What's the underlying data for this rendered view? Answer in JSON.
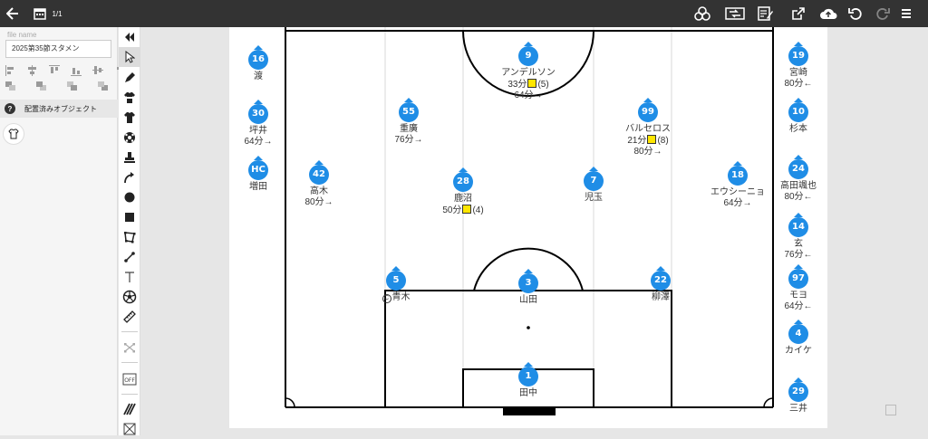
{
  "topbar": {
    "page_counter": "1/1",
    "icons": [
      "back-arrow-icon",
      "calendar-icon",
      "circles-icon",
      "substitution-icon",
      "edit-note-icon",
      "share-icon",
      "cloud-upload-icon",
      "undo-icon",
      "redo-icon",
      "menu-icon"
    ]
  },
  "sidebar": {
    "file_name_label": "file name",
    "file_name_value": "2025第35節スタメン",
    "objects_header": "配置済みオブジェクト"
  },
  "toolbar": {
    "tools": [
      "collapse",
      "select",
      "pen",
      "shirt-dark",
      "shirt-black",
      "ball",
      "stamp",
      "curve-arrow",
      "circle",
      "rectangle",
      "polygon",
      "line",
      "text",
      "ball-outline",
      "ruler",
      "formation",
      "off",
      "stripes",
      "pattern"
    ]
  },
  "pitch": {
    "starters": [
      {
        "id": "p9",
        "number": "9",
        "name": "アンデルソン",
        "lines": [
          {
            "pre": "33分",
            "card": "yellow",
            "post": "(5)"
          },
          {
            "text": "64分→"
          }
        ]
      },
      {
        "id": "p55",
        "number": "55",
        "name": "重廣",
        "lines": [
          {
            "text": "76分→"
          }
        ]
      },
      {
        "id": "p99",
        "number": "99",
        "name": "バルセロス",
        "lines": [
          {
            "pre": "21分",
            "card": "yellow",
            "post": "(8)"
          },
          {
            "text": "80分→"
          }
        ]
      },
      {
        "id": "p42",
        "number": "42",
        "name": "高木",
        "lines": [
          {
            "text": "80分→"
          }
        ]
      },
      {
        "id": "p28",
        "number": "28",
        "name": "鹿沼",
        "lines": [
          {
            "pre": "50分",
            "card": "yellow",
            "post": "(4)"
          }
        ]
      },
      {
        "id": "p7",
        "number": "7",
        "name": "児玉",
        "lines": []
      },
      {
        "id": "p18",
        "number": "18",
        "name": "エウシーニョ",
        "lines": [
          {
            "text": "64分→"
          }
        ]
      },
      {
        "id": "p5",
        "number": "5",
        "name": "青木",
        "captain": "C",
        "lines": []
      },
      {
        "id": "p3",
        "number": "3",
        "name": "山田",
        "lines": []
      },
      {
        "id": "p22",
        "number": "22",
        "name": "柳澤",
        "lines": []
      },
      {
        "id": "p1",
        "number": "1",
        "name": "田中",
        "lines": []
      }
    ],
    "bench_left": [
      {
        "id": "b16",
        "number": "16",
        "name": "渡",
        "lines": []
      },
      {
        "id": "b30",
        "number": "30",
        "name": "坪井",
        "lines": [
          {
            "text": "64分→"
          }
        ]
      },
      {
        "id": "bHC",
        "number": "HC",
        "name": "増田",
        "lines": []
      }
    ],
    "bench_right": [
      {
        "id": "b19",
        "number": "19",
        "name": "宮崎",
        "lines": [
          {
            "text": "80分←"
          }
        ]
      },
      {
        "id": "b10",
        "number": "10",
        "name": "杉本",
        "lines": []
      },
      {
        "id": "b24",
        "number": "24",
        "name": "高田颯也",
        "lines": [
          {
            "text": "80分←"
          }
        ]
      },
      {
        "id": "b14",
        "number": "14",
        "name": "玄",
        "lines": [
          {
            "text": "76分←"
          }
        ]
      },
      {
        "id": "b97",
        "number": "97",
        "name": "モヨ",
        "lines": [
          {
            "text": "64分←"
          }
        ]
      },
      {
        "id": "b4",
        "number": "4",
        "name": "カイケ",
        "lines": []
      },
      {
        "id": "b29",
        "number": "29",
        "name": "三井",
        "lines": []
      }
    ]
  }
}
